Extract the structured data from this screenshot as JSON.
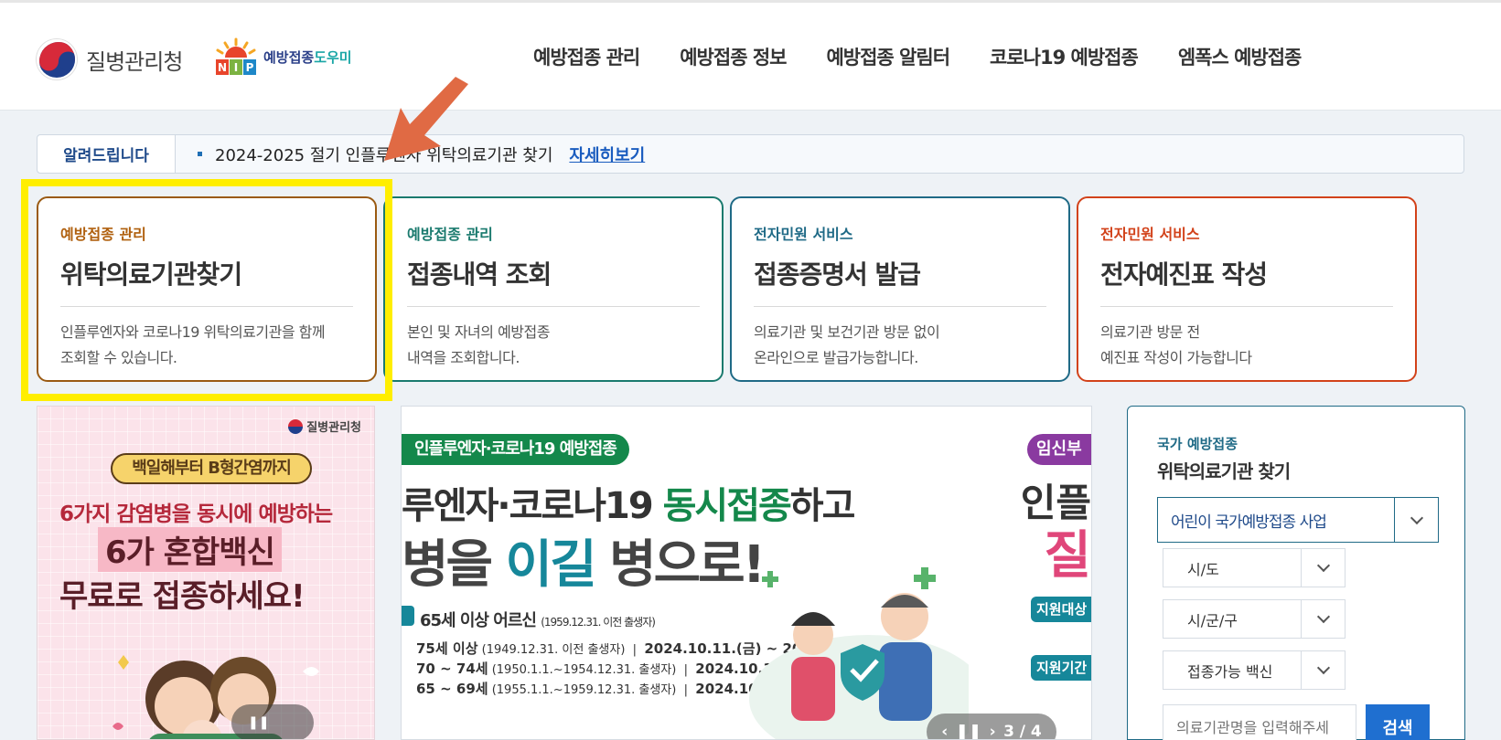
{
  "header": {
    "logo_text": "질병관리청",
    "nip_letters": [
      "N",
      "I",
      "P"
    ],
    "nip_text_main": "예방접종",
    "nip_text_accent": "도우미",
    "nav": [
      "예방접종 관리",
      "예방접종 정보",
      "예방접종 알림터",
      "코로나19 예방접종",
      "엠폭스 예방접종"
    ]
  },
  "notice": {
    "label": "알려드립니다",
    "text": "2024-2025 절기 인플루엔자 위탁의료기관 찾기",
    "more": "자세히보기"
  },
  "cards": [
    {
      "category": "예방접종 관리",
      "title": "위탁의료기관찾기",
      "desc": "인플루엔자와 코로나19 위탁의료기관을 함께\n조회할 수 있습니다.",
      "color": "#9a5a12"
    },
    {
      "category": "예방접종 관리",
      "title": "접종내역 조회",
      "desc": "본인 및 자녀의 예방접종\n내역을 조회합니다.",
      "color": "#1a7a6e"
    },
    {
      "category": "전자민원 서비스",
      "title": "접종증명서 발급",
      "desc": "의료기관 및 보건기관 방문 없이\n온라인으로 발급가능합니다.",
      "color": "#1f6a86"
    },
    {
      "category": "전자민원 서비스",
      "title": "전자예진표 작성",
      "desc": "의료기관 방문 전\n예진표 작성이 가능합니다",
      "color": "#d2421a"
    }
  ],
  "poster": {
    "org": "질병관리청",
    "pill": "백일해부터 B형간염까지",
    "line1": "6가지 감염병을 동시에 예방하는",
    "line2": "6가 혼합백신",
    "line3": "무료로 접종하세요!",
    "control": "❚❚"
  },
  "banner": {
    "tag": "인플루엔자·코로나19 예방접종",
    "headline_prefix": "루엔자·코로나19 ",
    "headline_hl": "동시접종",
    "headline_suffix": "하고",
    "big_prefix": "병을 ",
    "big_hl": "이길",
    "big_suffix": " 병으로!",
    "age_group": "65세 이상 어르신",
    "age_note": "(1959.12.31. 이전 출생자)",
    "schedule": [
      {
        "age": "75세 이상",
        "note": "(1949.12.31. 이전 출생자)",
        "period": "2024.10.11.(금) ~ 2025.4.30.(수)"
      },
      {
        "age": "70 ~ 74세",
        "note": "(1950.1.1.~1954.12.31. 출생자)",
        "period": "2024.10.15.(화) ~ 2025.4.30.(수)"
      },
      {
        "age": "65 ~ 69세",
        "note": "(1955.1.1.~1959.12.31. 출생자)",
        "period": "2024.10.18.(금) ~ 2025.4.30.(수)"
      }
    ],
    "right_tag": "임신부",
    "right_line1": "인플",
    "right_line2": "질",
    "right_badge1": "지원대상",
    "right_badge2": "지원기간",
    "slide_counter": "3 / 4"
  },
  "search": {
    "subtitle": "국가 예방접종",
    "title": "위탁의료기관 찾기",
    "program": "어린이 국가예방접종 사업",
    "sido": "시/도",
    "sigungu": "시/군/구",
    "vaccine": "접종가능 백신",
    "input_placeholder": "의료기관명을 입력해주세",
    "button": "검색"
  },
  "colors": {
    "highlight": "#ffee00",
    "arrow": "#e06a44",
    "accent": "#1f6a86"
  }
}
